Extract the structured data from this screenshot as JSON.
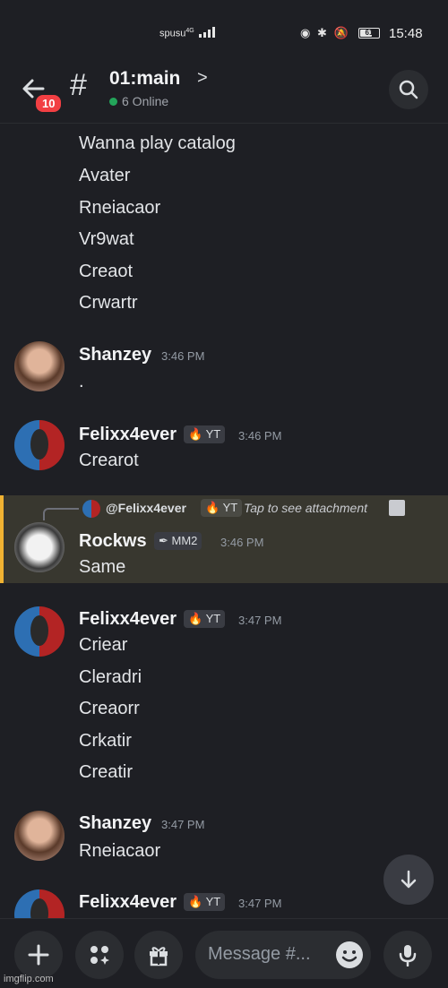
{
  "status_bar": {
    "carrier": "spusu",
    "carrier_sup": "4G",
    "battery": "61",
    "time": "15:48"
  },
  "header": {
    "unread_badge": "10",
    "hash": "#",
    "channel_name": "01:main",
    "chevron": ">",
    "online_text": "6 Online"
  },
  "messages": {
    "first_lines": [
      "Wanna play catalog",
      "Avater",
      "Rneiacaor",
      "Vr9wat",
      "Creaot",
      "Crwartr"
    ],
    "shanzey1": {
      "author": "Shanzey",
      "time": "3:46 PM",
      "lines": [
        "."
      ]
    },
    "felix1": {
      "author": "Felixx4ever",
      "tag": "YT",
      "time": "3:46 PM",
      "lines": [
        "Crearot"
      ]
    },
    "reply": {
      "ref_user": "@Felixx4ever",
      "ref_tag": "YT",
      "ref_text": "Tap to see attachment"
    },
    "rockws": {
      "author": "Rockws",
      "tag": "MM2",
      "time": "3:46 PM",
      "lines": [
        "Same"
      ]
    },
    "felix2": {
      "author": "Felixx4ever",
      "tag": "YT",
      "time": "3:47 PM",
      "lines": [
        "Criear",
        "Cleradri",
        "Creaorr",
        "Crkatir",
        "Creatir"
      ]
    },
    "shanzey2": {
      "author": "Shanzey",
      "time": "3:47 PM",
      "lines": [
        "Rneiacaor"
      ]
    },
    "felix3": {
      "author": "Felixx4ever",
      "tag": "YT",
      "time": "3:47 PM"
    }
  },
  "composer": {
    "placeholder": "Message #..."
  },
  "icons": {
    "back": "arrow-left-icon",
    "search": "search-icon",
    "plus": "plus-icon",
    "apps": "apps-icon",
    "gift": "gift-icon",
    "emoji": "emoji-icon",
    "mic": "microphone-icon",
    "scroll": "arrow-down-icon"
  },
  "watermark": "imgflip.com",
  "colors": {
    "background": "#1e1f24",
    "accent_reply": "#f0b232",
    "online": "#23a55a",
    "badge": "#f23f43"
  }
}
